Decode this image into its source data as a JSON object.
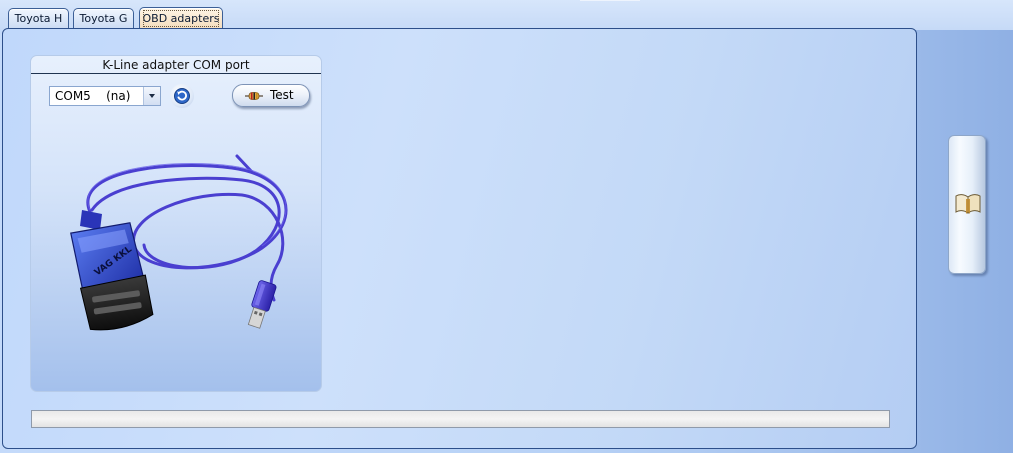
{
  "tabs": [
    {
      "label": "Toyota H",
      "active": false
    },
    {
      "label": "Toyota G",
      "active": false
    },
    {
      "label": "OBD adapters",
      "active": true
    }
  ],
  "group": {
    "title": "K-Line adapter COM port"
  },
  "com_port": {
    "selected": "COM5    (na)"
  },
  "buttons": {
    "test_label": "Test",
    "refresh_icon": "refresh-icon",
    "side_icon": "book-icon"
  },
  "adapter_image": {
    "label": "VAG KKL"
  },
  "progress": {
    "value": 0
  },
  "colors": {
    "accent_border": "#2d4f8a",
    "active_tab": "#f4dcbc",
    "cable": "#4a3fd0"
  }
}
